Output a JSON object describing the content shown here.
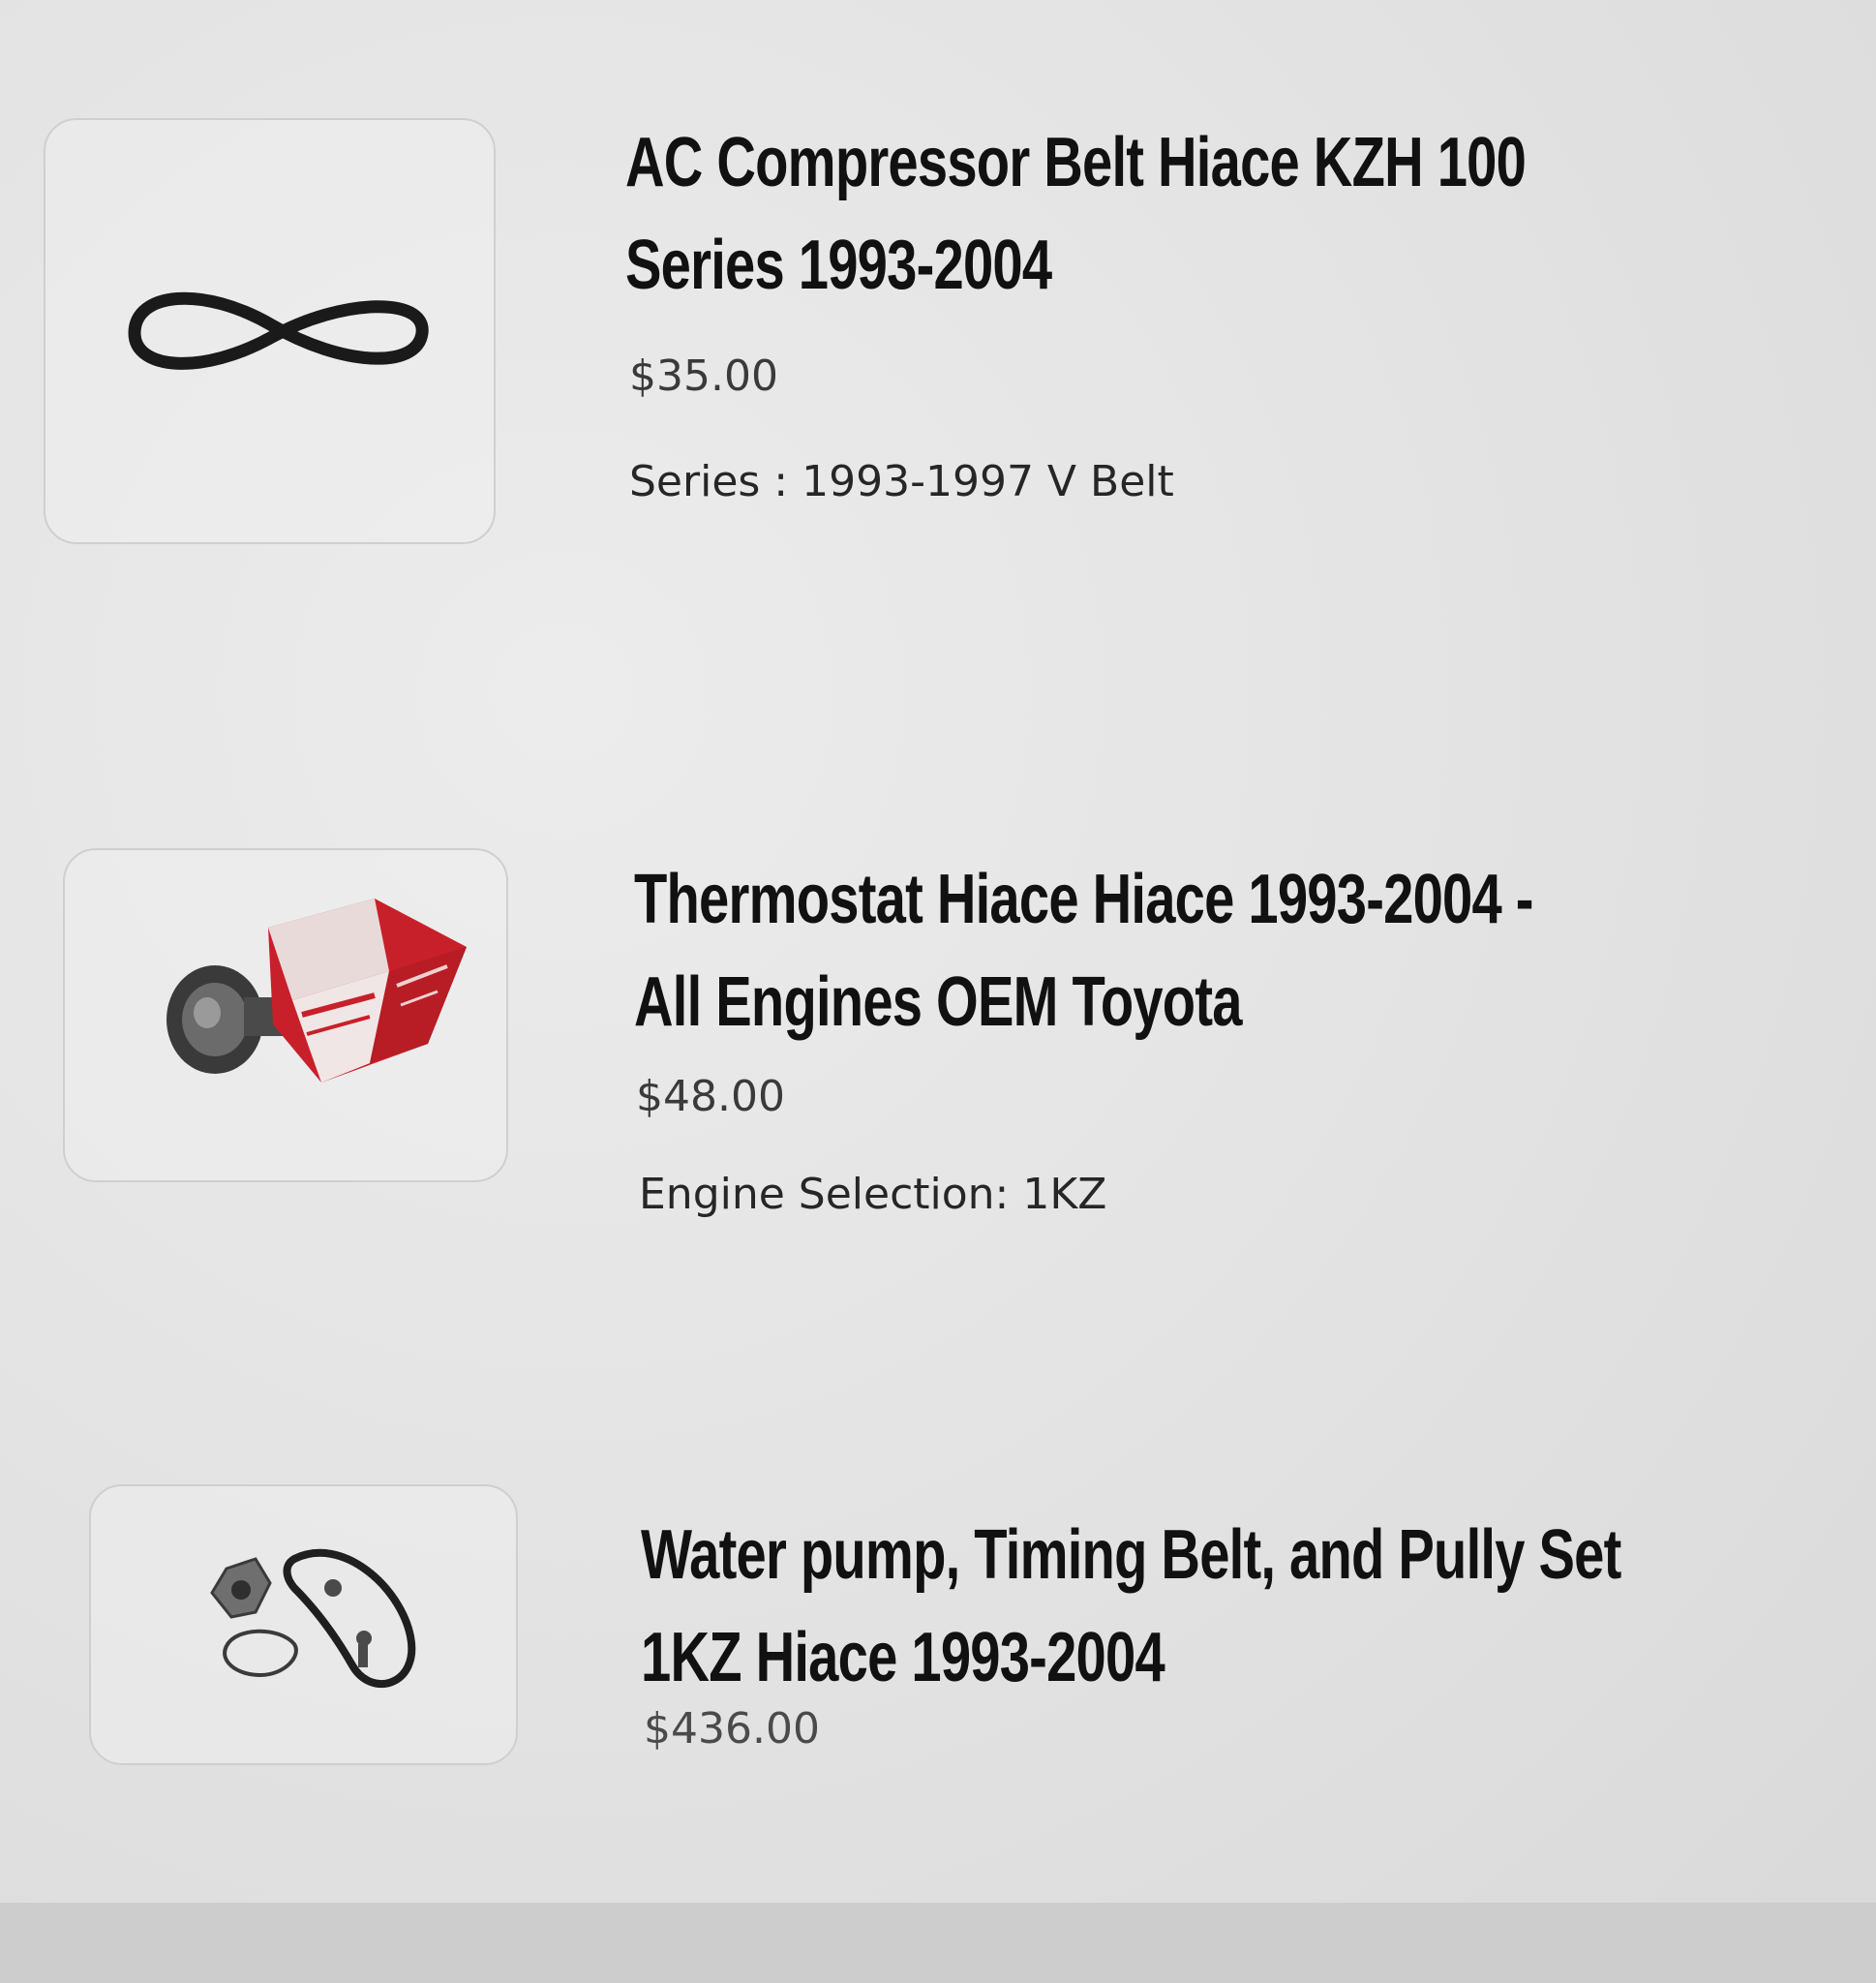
{
  "products": [
    {
      "title_line1": "AC Compressor Belt Hiace KZH 100",
      "title_line2": "Series 1993-2004",
      "price": "$35.00",
      "option": "Series : 1993-1997 V Belt",
      "image_icon": "v-belt-icon"
    },
    {
      "title_line1": "Thermostat Hiace Hiace 1993-2004 -",
      "title_line2": "All Engines OEM Toyota",
      "price": "$48.00",
      "option": "Engine Selection: 1KZ",
      "image_icon": "thermostat-box-icon"
    },
    {
      "title_line1": "Water pump, Timing Belt, and Pully Set",
      "title_line2": "1KZ Hiace 1993-2004",
      "price": "$436.00",
      "image_icon": "water-pump-kit-icon"
    }
  ],
  "colors": {
    "background": "#e4e4e4",
    "title": "#111111",
    "price": "#3a3a3a",
    "thumb_border": "#cfcfcf",
    "toyota_red": "#c8202a"
  }
}
